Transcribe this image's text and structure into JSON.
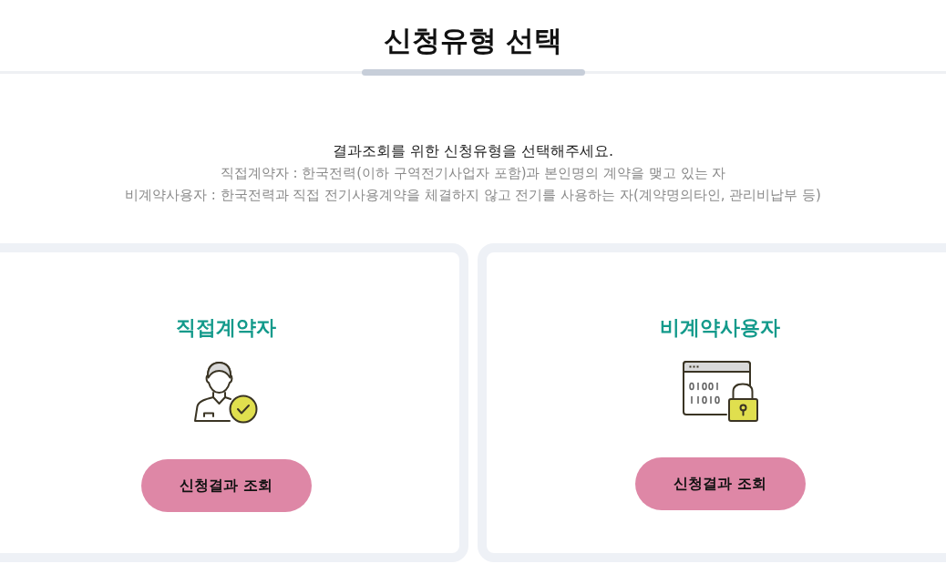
{
  "page": {
    "title": "신청유형 선택"
  },
  "intro": {
    "heading": "결과조회를 위한 신청유형을 선택해주세요.",
    "notes": [
      "직접계약자 : 한국전력(이하 구역전기사업자 포함)과 본인명의 계약을 맺고 있는 자",
      "비계약사용자 : 한국전력과 직접 전기사용계약을 체결하지 않고 전기를 사용하는 자(계약명의타인, 관리비납부 등)"
    ]
  },
  "options": [
    {
      "kind": "direct",
      "title": "직접계약자",
      "button": "신청결과 조회"
    },
    {
      "kind": "noncontract",
      "title": "비계약사용자",
      "button": "신청결과 조회"
    }
  ]
}
